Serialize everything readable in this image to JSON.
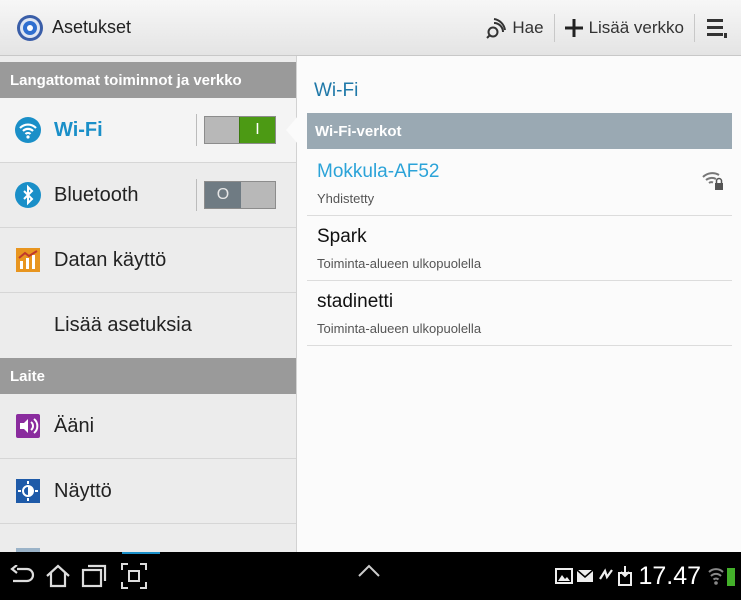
{
  "app": {
    "title": "Asetukset"
  },
  "actionbar": {
    "search_label": "Hae",
    "add_network_label": "Lisää verkko"
  },
  "left_panel": {
    "section_wireless": "Langattomat toiminnot ja verkko",
    "items": [
      {
        "label": "Wi-Fi",
        "toggle": "I"
      },
      {
        "label": "Bluetooth",
        "toggle": "O"
      },
      {
        "label": "Datan käyttö"
      },
      {
        "label": "Lisää asetuksia"
      }
    ],
    "section_device": "Laite",
    "device_items": [
      {
        "label": "Ääni"
      },
      {
        "label": "Näyttö"
      }
    ]
  },
  "right_panel": {
    "title": "Wi-Fi",
    "networks_header": "Wi-Fi-verkot",
    "networks": [
      {
        "name": "Mokkula-AF52",
        "status": "Yhdistetty"
      },
      {
        "name": "Spark",
        "status": "Toiminta-alueen ulkopuolella"
      },
      {
        "name": "stadinetti",
        "status": "Toiminta-alueen ulkopuolella"
      }
    ]
  },
  "statusbar": {
    "time": "17.47"
  },
  "colors": {
    "accent": "#1a8fc8",
    "toggle_on": "#4c9a14",
    "section_header": "#9a9a9a",
    "network_header": "#9aa9b3"
  }
}
